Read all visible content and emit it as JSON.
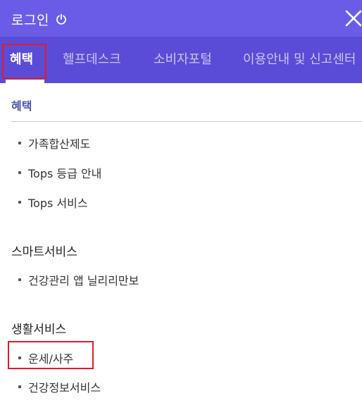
{
  "header": {
    "login_label": "로그인",
    "power_icon": "power-icon",
    "close_icon": "close-icon"
  },
  "tabs": [
    {
      "label": "혜택",
      "active": true
    },
    {
      "label": "헬프데스크",
      "active": false
    },
    {
      "label": "소비자포털",
      "active": false
    },
    {
      "label": "이용안내 및 신고센터",
      "active": false
    }
  ],
  "sections": [
    {
      "title": "혜택",
      "items": [
        "가족합산제도",
        "Tops 등급 안내",
        "Tops 서비스"
      ]
    },
    {
      "title": "스마트서비스",
      "items": [
        "건강관리 앱 닐리리만보"
      ]
    },
    {
      "title": "생활서비스",
      "items": [
        "운세/사주",
        "건강정보서비스"
      ]
    }
  ],
  "colors": {
    "header_bg": "#6b5ce7",
    "tabs_bg": "#5a4cd6",
    "highlight": "#e11b2b",
    "section_accent": "#4a57b8"
  }
}
